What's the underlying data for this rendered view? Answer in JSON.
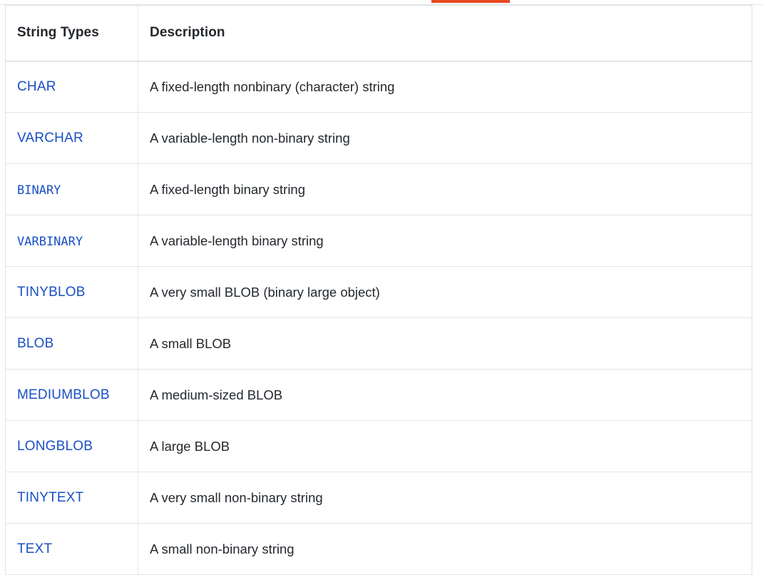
{
  "tab_bar": {
    "active_indicator_color": "#e8491f",
    "border_color": "#e3e5e8"
  },
  "theme": {
    "link_color": "#1a4fc4",
    "text_color": "#24292e",
    "border_color": "#e1e4e8",
    "background": "#ffffff"
  },
  "table": {
    "columns": [
      {
        "label": "String Types",
        "key": "type"
      },
      {
        "label": "Description",
        "key": "description"
      }
    ],
    "rows": [
      {
        "type": "CHAR",
        "type_style": "sans",
        "description": "A fixed-length nonbinary (character) string"
      },
      {
        "type": "VARCHAR",
        "type_style": "sans",
        "description": "A variable-length non-binary string"
      },
      {
        "type": "BINARY",
        "type_style": "mono",
        "description": "A fixed-length binary string"
      },
      {
        "type": "VARBINARY",
        "type_style": "mono",
        "description": "A variable-length binary string"
      },
      {
        "type": "TINYBLOB",
        "type_style": "sans",
        "description": "A very small BLOB (binary large object)"
      },
      {
        "type": "BLOB",
        "type_style": "sans",
        "description": "A small BLOB"
      },
      {
        "type": "MEDIUMBLOB",
        "type_style": "sans",
        "description": "A medium-sized BLOB"
      },
      {
        "type": "LONGBLOB",
        "type_style": "sans",
        "description": "A large BLOB"
      },
      {
        "type": "TINYTEXT",
        "type_style": "sans",
        "description": "A very small non-binary string"
      },
      {
        "type": "TEXT",
        "type_style": "sans",
        "description": "A small non-binary string"
      }
    ]
  }
}
